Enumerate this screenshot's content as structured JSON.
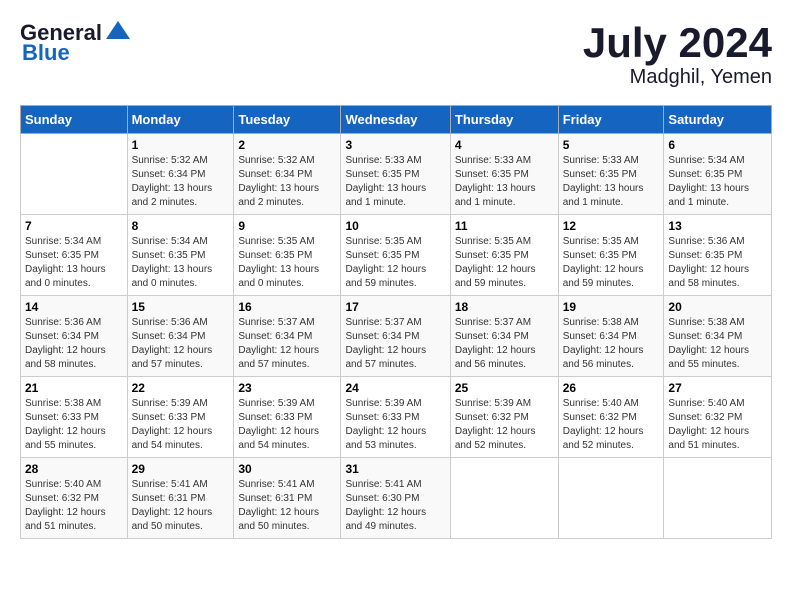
{
  "logo": {
    "line1": "General",
    "line2": "Blue"
  },
  "title": "July 2024",
  "subtitle": "Madghil, Yemen",
  "days_of_week": [
    "Sunday",
    "Monday",
    "Tuesday",
    "Wednesday",
    "Thursday",
    "Friday",
    "Saturday"
  ],
  "weeks": [
    [
      {
        "day": "",
        "info": ""
      },
      {
        "day": "1",
        "info": "Sunrise: 5:32 AM\nSunset: 6:34 PM\nDaylight: 13 hours\nand 2 minutes."
      },
      {
        "day": "2",
        "info": "Sunrise: 5:32 AM\nSunset: 6:34 PM\nDaylight: 13 hours\nand 2 minutes."
      },
      {
        "day": "3",
        "info": "Sunrise: 5:33 AM\nSunset: 6:35 PM\nDaylight: 13 hours\nand 1 minute."
      },
      {
        "day": "4",
        "info": "Sunrise: 5:33 AM\nSunset: 6:35 PM\nDaylight: 13 hours\nand 1 minute."
      },
      {
        "day": "5",
        "info": "Sunrise: 5:33 AM\nSunset: 6:35 PM\nDaylight: 13 hours\nand 1 minute."
      },
      {
        "day": "6",
        "info": "Sunrise: 5:34 AM\nSunset: 6:35 PM\nDaylight: 13 hours\nand 1 minute."
      }
    ],
    [
      {
        "day": "7",
        "info": "Sunrise: 5:34 AM\nSunset: 6:35 PM\nDaylight: 13 hours\nand 0 minutes."
      },
      {
        "day": "8",
        "info": "Sunrise: 5:34 AM\nSunset: 6:35 PM\nDaylight: 13 hours\nand 0 minutes."
      },
      {
        "day": "9",
        "info": "Sunrise: 5:35 AM\nSunset: 6:35 PM\nDaylight: 13 hours\nand 0 minutes."
      },
      {
        "day": "10",
        "info": "Sunrise: 5:35 AM\nSunset: 6:35 PM\nDaylight: 12 hours\nand 59 minutes."
      },
      {
        "day": "11",
        "info": "Sunrise: 5:35 AM\nSunset: 6:35 PM\nDaylight: 12 hours\nand 59 minutes."
      },
      {
        "day": "12",
        "info": "Sunrise: 5:35 AM\nSunset: 6:35 PM\nDaylight: 12 hours\nand 59 minutes."
      },
      {
        "day": "13",
        "info": "Sunrise: 5:36 AM\nSunset: 6:35 PM\nDaylight: 12 hours\nand 58 minutes."
      }
    ],
    [
      {
        "day": "14",
        "info": "Sunrise: 5:36 AM\nSunset: 6:34 PM\nDaylight: 12 hours\nand 58 minutes."
      },
      {
        "day": "15",
        "info": "Sunrise: 5:36 AM\nSunset: 6:34 PM\nDaylight: 12 hours\nand 57 minutes."
      },
      {
        "day": "16",
        "info": "Sunrise: 5:37 AM\nSunset: 6:34 PM\nDaylight: 12 hours\nand 57 minutes."
      },
      {
        "day": "17",
        "info": "Sunrise: 5:37 AM\nSunset: 6:34 PM\nDaylight: 12 hours\nand 57 minutes."
      },
      {
        "day": "18",
        "info": "Sunrise: 5:37 AM\nSunset: 6:34 PM\nDaylight: 12 hours\nand 56 minutes."
      },
      {
        "day": "19",
        "info": "Sunrise: 5:38 AM\nSunset: 6:34 PM\nDaylight: 12 hours\nand 56 minutes."
      },
      {
        "day": "20",
        "info": "Sunrise: 5:38 AM\nSunset: 6:34 PM\nDaylight: 12 hours\nand 55 minutes."
      }
    ],
    [
      {
        "day": "21",
        "info": "Sunrise: 5:38 AM\nSunset: 6:33 PM\nDaylight: 12 hours\nand 55 minutes."
      },
      {
        "day": "22",
        "info": "Sunrise: 5:39 AM\nSunset: 6:33 PM\nDaylight: 12 hours\nand 54 minutes."
      },
      {
        "day": "23",
        "info": "Sunrise: 5:39 AM\nSunset: 6:33 PM\nDaylight: 12 hours\nand 54 minutes."
      },
      {
        "day": "24",
        "info": "Sunrise: 5:39 AM\nSunset: 6:33 PM\nDaylight: 12 hours\nand 53 minutes."
      },
      {
        "day": "25",
        "info": "Sunrise: 5:39 AM\nSunset: 6:32 PM\nDaylight: 12 hours\nand 52 minutes."
      },
      {
        "day": "26",
        "info": "Sunrise: 5:40 AM\nSunset: 6:32 PM\nDaylight: 12 hours\nand 52 minutes."
      },
      {
        "day": "27",
        "info": "Sunrise: 5:40 AM\nSunset: 6:32 PM\nDaylight: 12 hours\nand 51 minutes."
      }
    ],
    [
      {
        "day": "28",
        "info": "Sunrise: 5:40 AM\nSunset: 6:32 PM\nDaylight: 12 hours\nand 51 minutes."
      },
      {
        "day": "29",
        "info": "Sunrise: 5:41 AM\nSunset: 6:31 PM\nDaylight: 12 hours\nand 50 minutes."
      },
      {
        "day": "30",
        "info": "Sunrise: 5:41 AM\nSunset: 6:31 PM\nDaylight: 12 hours\nand 50 minutes."
      },
      {
        "day": "31",
        "info": "Sunrise: 5:41 AM\nSunset: 6:30 PM\nDaylight: 12 hours\nand 49 minutes."
      },
      {
        "day": "",
        "info": ""
      },
      {
        "day": "",
        "info": ""
      },
      {
        "day": "",
        "info": ""
      }
    ]
  ]
}
